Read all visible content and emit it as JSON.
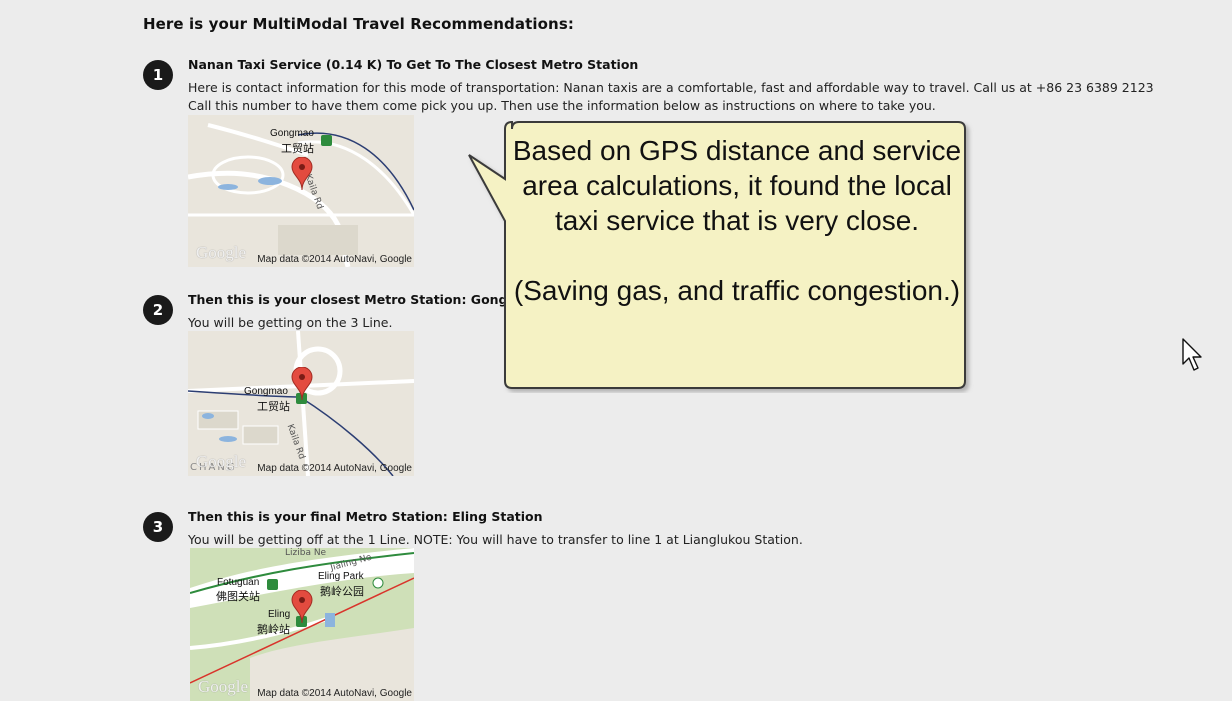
{
  "page": {
    "title": "Here is your MultiModal Travel Recommendations:"
  },
  "steps": [
    {
      "number": "1",
      "heading": "Nanan Taxi Service (0.14 K)  To Get To The Closest Metro Station",
      "lines": [
        "Here is contact information for this mode of transportation: Nanan taxis are a comfortable, fast and affordable way to travel. Call us at +86 23 6389 2123",
        "Call this number to have them come pick you up. Then use the information below as instructions on where to take you."
      ],
      "map": {
        "labels": [
          "Gongmao",
          "工贸站",
          "Kaila Rd"
        ],
        "credit": "Map data ©2014 AutoNavi, Google",
        "logo": "Google"
      }
    },
    {
      "number": "2",
      "heading": "Then this is your closest Metro Station: Gongmao",
      "lines": [
        " You will be getting on the 3 Line."
      ],
      "map": {
        "labels": [
          "Gongmao",
          "工贸站",
          "Kaila Rd",
          "CHANG"
        ],
        "credit": "Map data ©2014 AutoNavi, Google",
        "logo": "Google"
      }
    },
    {
      "number": "3",
      "heading": "Then this is your final Metro Station: Eling Station",
      "lines": [
        " You will be getting off at the 1 Line. NOTE: You will have to transfer to line 1 at Lianglukou Station."
      ],
      "map": {
        "labels": [
          "Liziba Ne",
          "Jialing Ne",
          "Fotuguan",
          "佛图关站",
          "Eling Park",
          "鹅岭公园",
          "Eling",
          "鹅岭站"
        ],
        "credit": "Map data ©2014 AutoNavi, Google",
        "logo": "Google"
      }
    }
  ],
  "callout": {
    "text": "Based on GPS distance and service area calculations, it found the local taxi service that is very close.\n\n(Saving gas, and traffic congestion.)",
    "fill_color": "#f5f2c4",
    "border_color": "#3a3a3a"
  },
  "colors": {
    "background": "#ececec",
    "marker": "#e34b3f",
    "metro_icon": "#2e8b3d",
    "line_red": "#d9342b"
  },
  "icons": {
    "cursor": "mouse-pointer-icon",
    "marker": "map-pin-icon",
    "metro": "metro-station-icon"
  }
}
